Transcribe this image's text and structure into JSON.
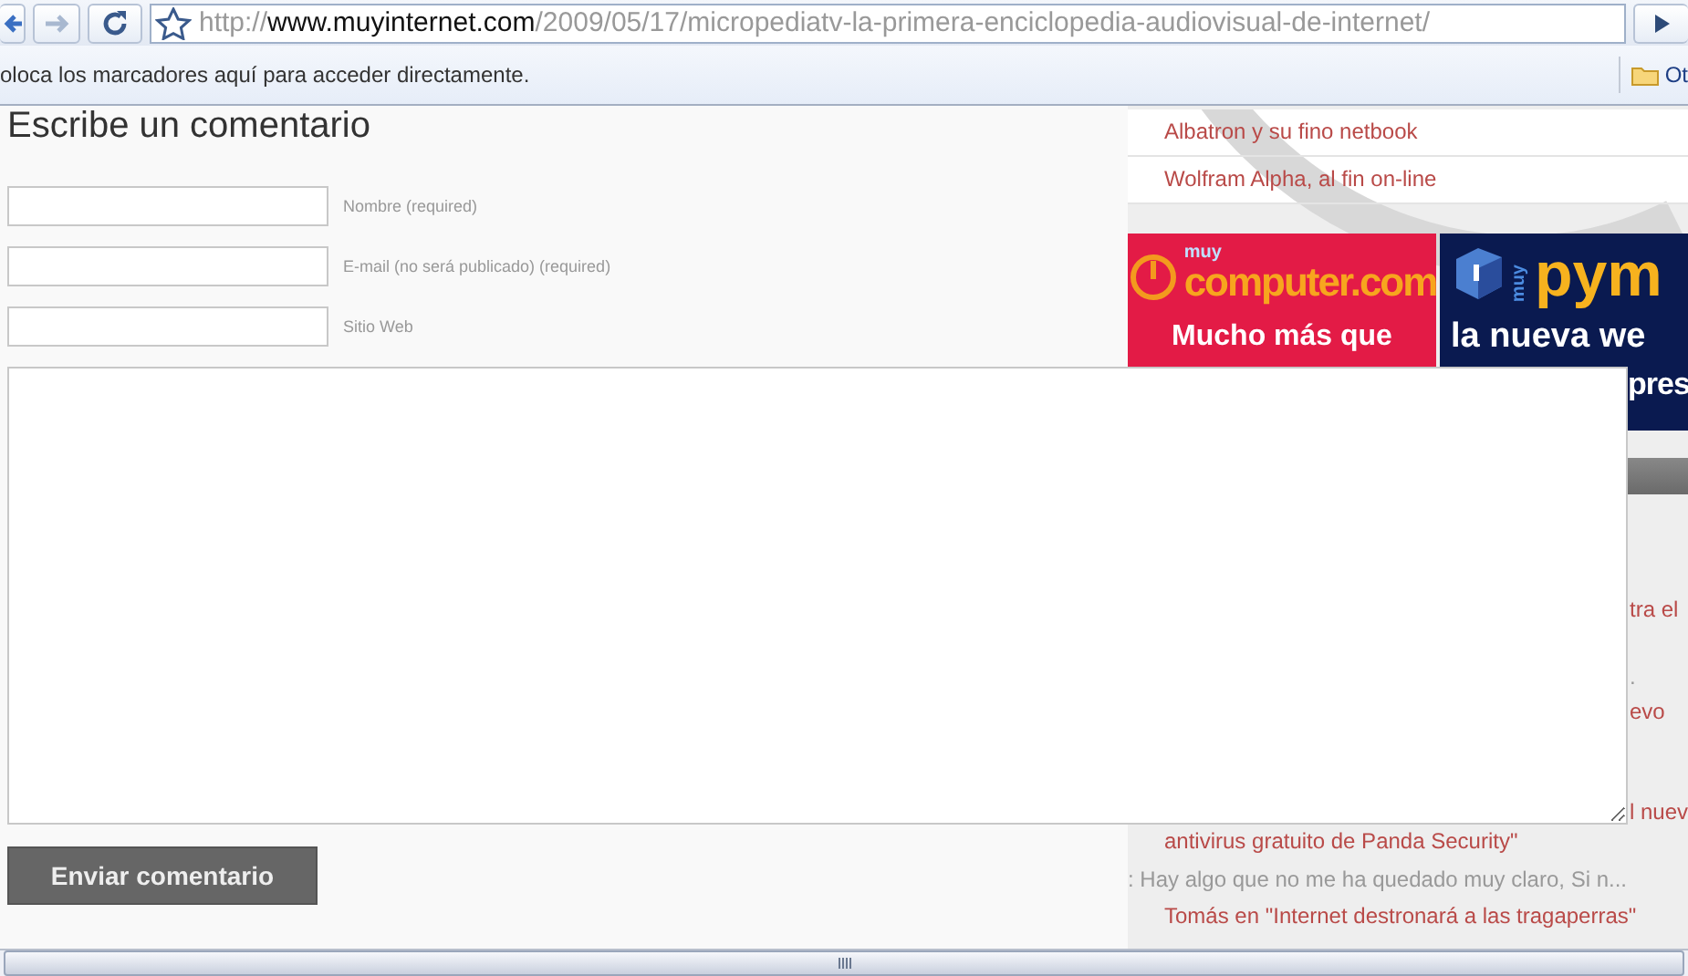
{
  "browser": {
    "url_scheme": "http://",
    "url_host": "www.muyinternet.com",
    "url_path": "/2009/05/17/micropediatv-la-primera-enciclopedia-audiovisual-de-internet/",
    "bookmarks_hint": "oloca los marcadores aquí para acceder directamente.",
    "other_bookmarks": "Ot"
  },
  "form": {
    "heading": "Escribe un comentario",
    "fields": [
      {
        "label": "Nombre (required)"
      },
      {
        "label": "E-mail (no será publicado) (required)"
      },
      {
        "label": "Sitio Web"
      }
    ],
    "button": "Enviar comentario"
  },
  "sidebar": {
    "links": [
      "Albatron y su fino netbook",
      "Wolfram Alpha, al fin on-line"
    ],
    "banners": [
      {
        "kind": "computer",
        "logo_small": "muy",
        "logo": "computer.com",
        "lines": [
          "Mucho más que"
        ]
      },
      {
        "kind": "pyme",
        "logo_small": "muy",
        "logo": "pym",
        "lines": [
          "la nueva we",
          "pres"
        ]
      }
    ],
    "comments": [
      {
        "kind": "link",
        "covered": true,
        "text": "tra el"
      },
      {
        "kind": "excerpt",
        "covered": true,
        "text": "."
      },
      {
        "kind": "link",
        "covered": true,
        "text": "evo"
      },
      {
        "kind": "link",
        "covered": true,
        "text": "l nuev"
      },
      {
        "kind": "link",
        "covered": false,
        "text": "antivirus gratuito de Panda Security\""
      },
      {
        "kind": "excerpt",
        "covered": false,
        "text": ": Hay algo que no me ha quedado muy claro, Si n..."
      },
      {
        "kind": "link",
        "covered": false,
        "text": "Tomás en \"Internet destronará a las tragaperras\""
      }
    ]
  }
}
